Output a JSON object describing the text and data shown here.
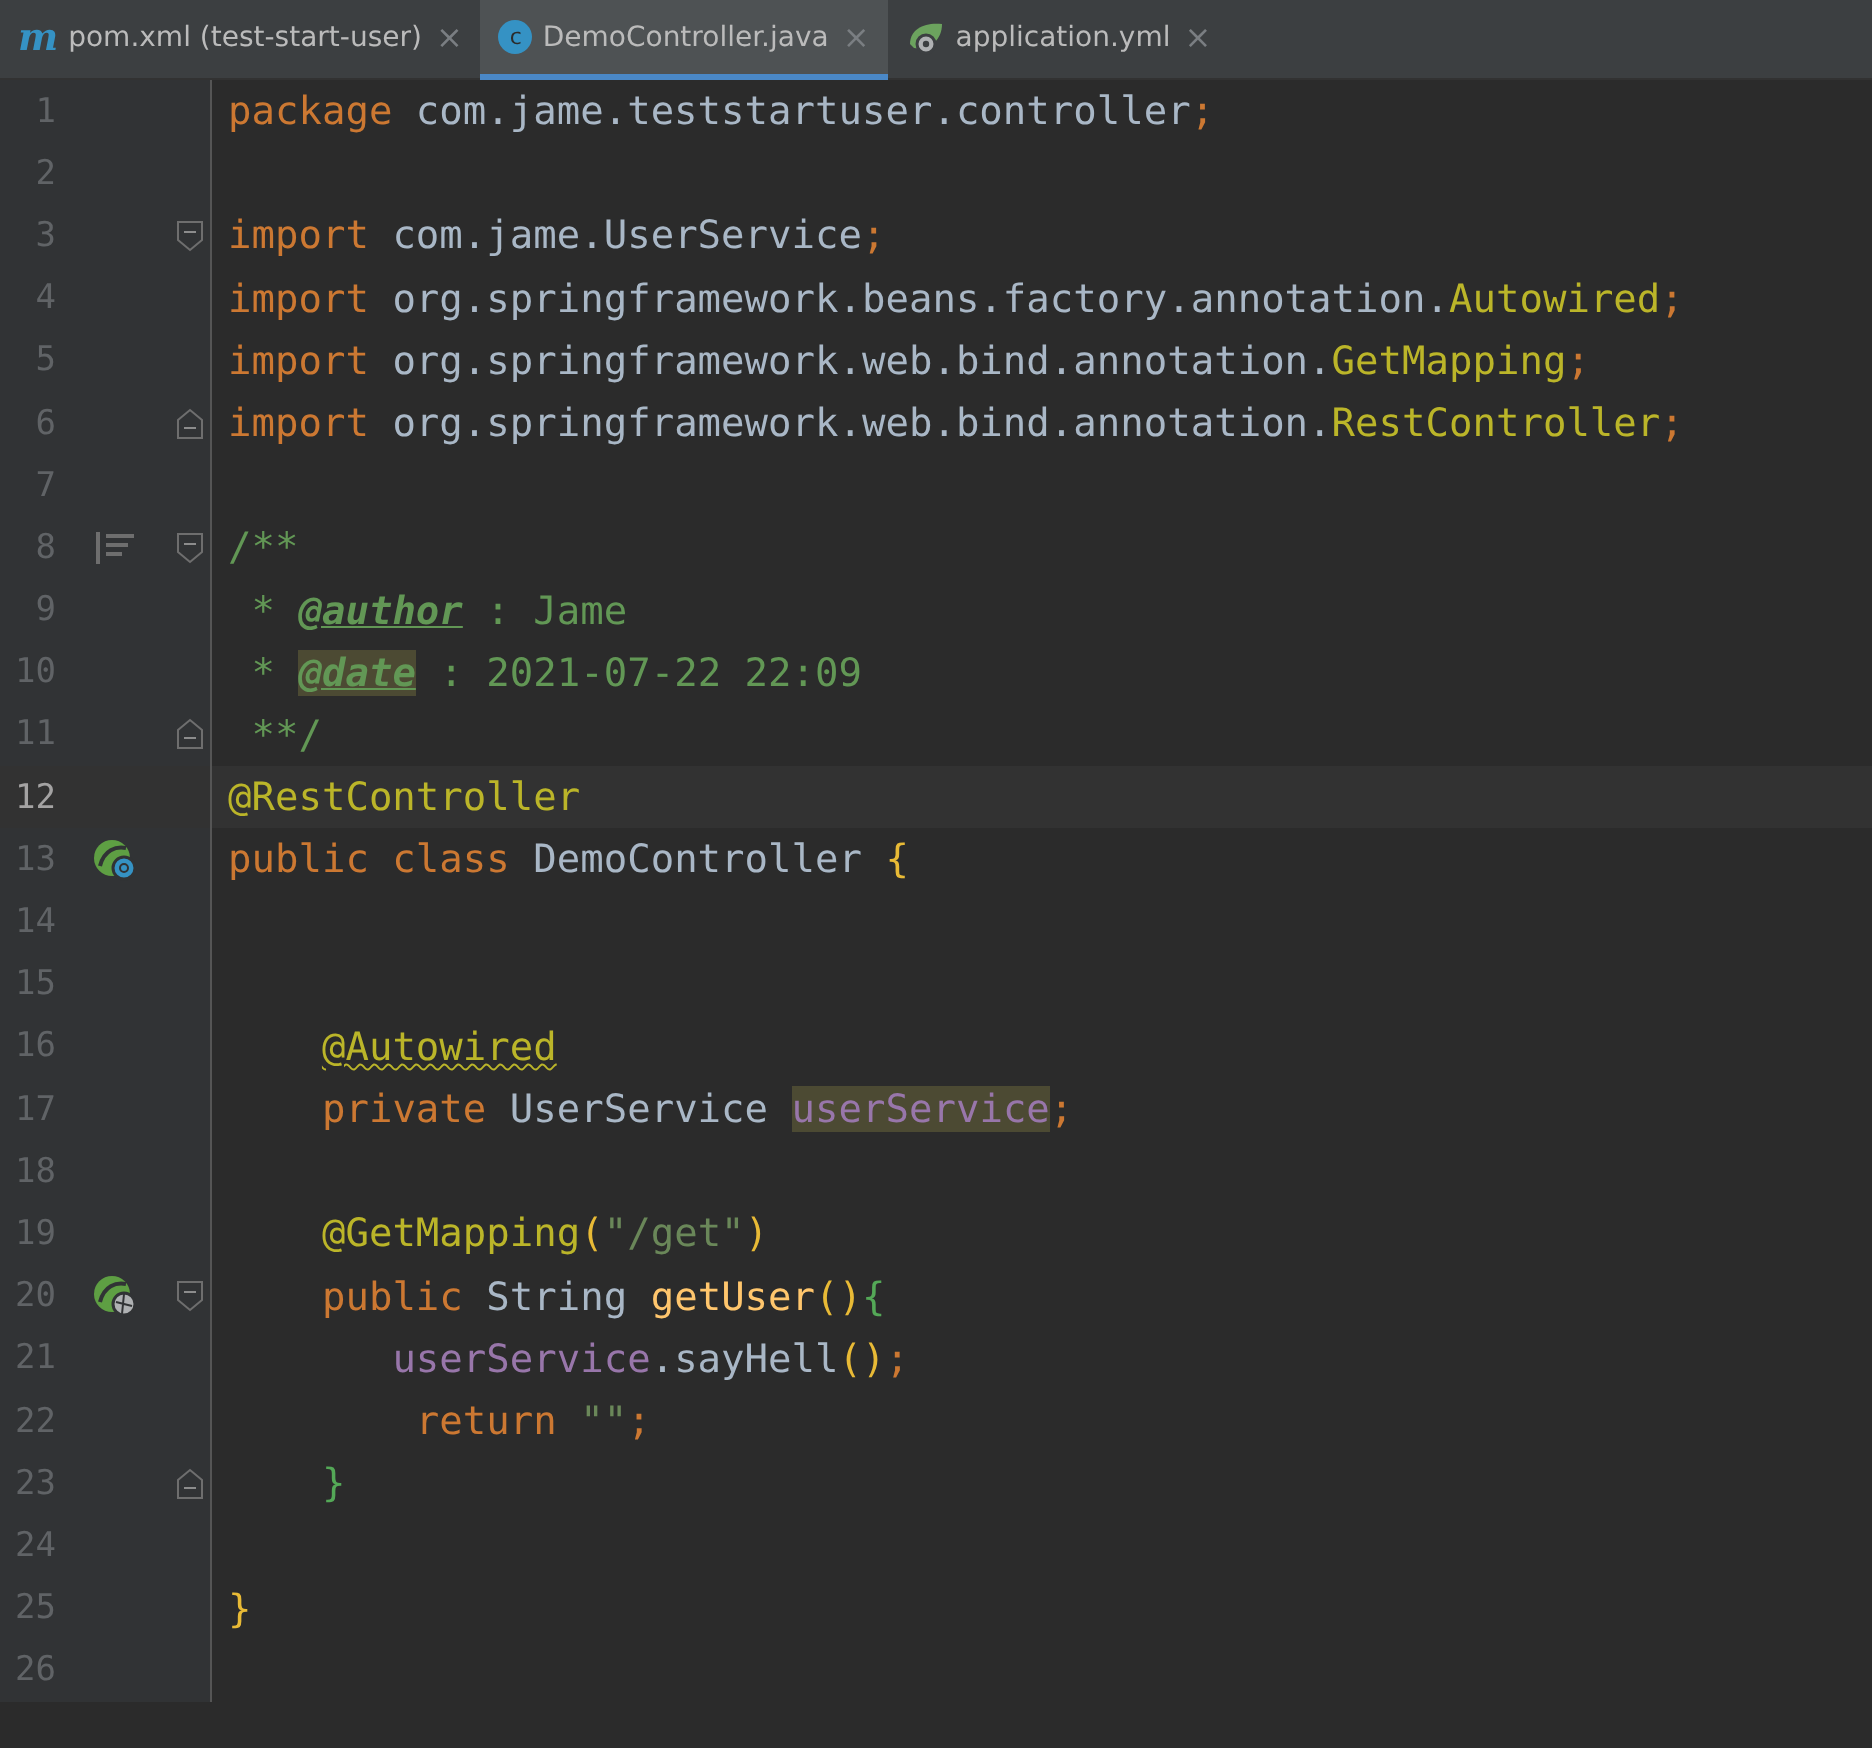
{
  "tabs": [
    {
      "kind": "maven",
      "glyph": "m",
      "label": "pom.xml (test-start-user)",
      "close": "×",
      "selected": false
    },
    {
      "kind": "class",
      "glyph": "c",
      "label": "DemoController.java",
      "close": "×",
      "selected": true
    },
    {
      "kind": "spring",
      "label": "application.yml",
      "close": "×",
      "selected": false
    }
  ],
  "lines": [
    {
      "number": "1",
      "current": false,
      "tokens": [
        {
          "text": "package ",
          "kind": "keyword"
        },
        {
          "text": "com.jame.teststartuser.controller",
          "kind": "plain"
        },
        {
          "text": ";",
          "kind": "keyword"
        }
      ]
    },
    {
      "number": "2",
      "current": false
    },
    {
      "number": "3",
      "current": false,
      "fold_open": true,
      "tokens": [
        {
          "text": "import ",
          "kind": "keyword"
        },
        {
          "text": "com.jame.UserService",
          "kind": "plain"
        },
        {
          "text": ";",
          "kind": "keyword"
        }
      ]
    },
    {
      "number": "4",
      "current": false,
      "tokens": [
        {
          "text": "import ",
          "kind": "keyword"
        },
        {
          "text": "org.springframework.beans.factory.annotation.",
          "kind": "plain"
        },
        {
          "text": "Autowired",
          "kind": "annotation"
        },
        {
          "text": ";",
          "kind": "keyword"
        }
      ]
    },
    {
      "number": "5",
      "current": false,
      "tokens": [
        {
          "text": "import ",
          "kind": "keyword"
        },
        {
          "text": "org.springframework.web.bind.annotation.",
          "kind": "plain"
        },
        {
          "text": "GetMapping",
          "kind": "annotation"
        },
        {
          "text": ";",
          "kind": "keyword"
        }
      ]
    },
    {
      "number": "6",
      "current": false,
      "fold_close": true,
      "tokens": [
        {
          "text": "import ",
          "kind": "keyword"
        },
        {
          "text": "org.springframework.web.bind.annotation.",
          "kind": "plain"
        },
        {
          "text": "RestController",
          "kind": "annotation"
        },
        {
          "text": ";",
          "kind": "keyword"
        }
      ]
    },
    {
      "number": "7",
      "current": false
    },
    {
      "number": "8",
      "current": false,
      "doc_toggle": true,
      "fold_open": true,
      "tokens": [
        {
          "text": "/**",
          "kind": "doc"
        }
      ]
    },
    {
      "number": "9",
      "current": false,
      "tokens": [
        {
          "text": " * ",
          "kind": "doc"
        },
        {
          "text": "@author",
          "kind": "doctag",
          "highlight": false
        },
        {
          "text": " : Jame",
          "kind": "doc"
        }
      ]
    },
    {
      "number": "10",
      "current": false,
      "tokens": [
        {
          "text": " * ",
          "kind": "doc"
        },
        {
          "text": "@date",
          "kind": "doctag",
          "highlight": true
        },
        {
          "text": " : 2021-07-22 22:09",
          "kind": "doc"
        }
      ]
    },
    {
      "number": "11",
      "current": false,
      "fold_close": true,
      "tokens": [
        {
          "text": " **/",
          "kind": "doc"
        }
      ]
    },
    {
      "number": "12",
      "current": true,
      "tokens": [
        {
          "text": "@RestController",
          "kind": "annotation"
        }
      ]
    },
    {
      "number": "13",
      "current": false,
      "class_bean": true,
      "tokens": [
        {
          "text": "public class ",
          "kind": "keyword"
        },
        {
          "text": "DemoController ",
          "kind": "plain"
        },
        {
          "text": "{",
          "kind": "brace1"
        }
      ]
    },
    {
      "number": "14",
      "current": false
    },
    {
      "number": "15",
      "current": false
    },
    {
      "number": "16",
      "current": false,
      "tokens": [
        {
          "text": "    @Autowired",
          "kind": "annotation",
          "warning": true
        }
      ]
    },
    {
      "number": "17",
      "current": false,
      "tokens": [
        {
          "text": "    private ",
          "kind": "keyword"
        },
        {
          "text": "UserService ",
          "kind": "plain"
        },
        {
          "text": "userService",
          "kind": "field",
          "highlight": true
        },
        {
          "text": ";",
          "kind": "keyword"
        }
      ]
    },
    {
      "number": "18",
      "current": false
    },
    {
      "number": "19",
      "current": false,
      "tokens": [
        {
          "text": "    @GetMapping",
          "kind": "annotation"
        },
        {
          "text": "(",
          "kind": "brace1"
        },
        {
          "text": "\"/get\"",
          "kind": "string"
        },
        {
          "text": ")",
          "kind": "brace1"
        }
      ]
    },
    {
      "number": "20",
      "current": false,
      "web_endpoint": true,
      "fold_open": true,
      "tokens": [
        {
          "text": "    public ",
          "kind": "keyword"
        },
        {
          "text": "String ",
          "kind": "plain"
        },
        {
          "text": "getUser",
          "kind": "method"
        },
        {
          "text": "()",
          "kind": "brace1"
        },
        {
          "text": "{",
          "kind": "brace2"
        }
      ]
    },
    {
      "number": "21",
      "current": false,
      "tokens": [
        {
          "text": "       userService",
          "kind": "field",
          "highlight": false
        },
        {
          "text": ".sayHell",
          "kind": "plain"
        },
        {
          "text": "()",
          "kind": "brace1"
        },
        {
          "text": ";",
          "kind": "keyword"
        }
      ]
    },
    {
      "number": "22",
      "current": false,
      "tokens": [
        {
          "text": "        return ",
          "kind": "keyword"
        },
        {
          "text": "\"\"",
          "kind": "string"
        },
        {
          "text": ";",
          "kind": "keyword"
        }
      ]
    },
    {
      "number": "23",
      "current": false,
      "fold_close": true,
      "tokens": [
        {
          "text": "    }",
          "kind": "brace2"
        }
      ]
    },
    {
      "number": "24",
      "current": false
    },
    {
      "number": "25",
      "current": false,
      "tokens": [
        {
          "text": "}",
          "kind": "brace1"
        }
      ]
    },
    {
      "number": "26",
      "current": false
    }
  ]
}
